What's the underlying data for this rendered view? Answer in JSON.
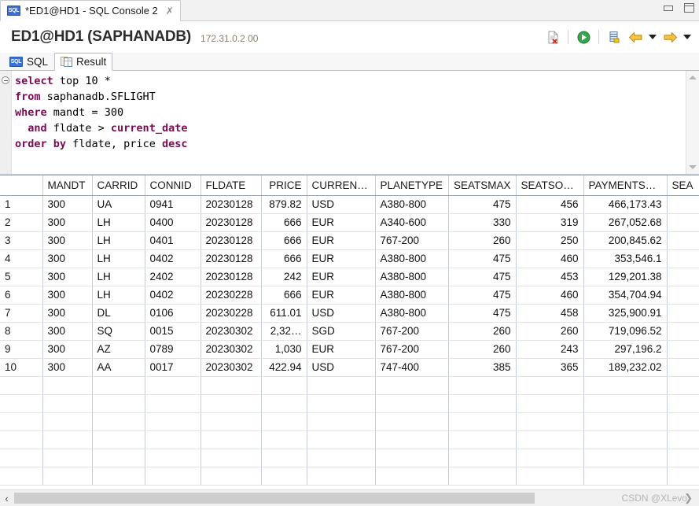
{
  "window": {
    "tab_title": "*ED1@HD1 - SQL Console 2",
    "tab_icon": "sql-badge-icon",
    "tab_close_glyph": "✗",
    "minimize_label": "Minimize",
    "maximize_label": "Maximize"
  },
  "header": {
    "title": "ED1@HD1 (SAPHANADB)",
    "host": "172.31.0.2 00",
    "tools": [
      {
        "name": "clear-console-icon",
        "title": "Clear console"
      },
      {
        "name": "execute-icon",
        "title": "Execute"
      },
      {
        "name": "save-to-db-icon",
        "title": "Save"
      },
      {
        "name": "back-arrow-icon",
        "title": "Back"
      },
      {
        "name": "back-dropdown-caret",
        "title": "Back history"
      },
      {
        "name": "forward-arrow-icon",
        "title": "Forward"
      },
      {
        "name": "forward-dropdown-caret",
        "title": "Forward history"
      }
    ]
  },
  "tabs": [
    {
      "label": "SQL",
      "icon": "sql-badge-icon",
      "active": false
    },
    {
      "label": "Result",
      "icon": "result-grid-icon",
      "active": true
    }
  ],
  "editor": {
    "lines": [
      [
        {
          "t": "select",
          "k": true
        },
        {
          "t": " top 10 *",
          "k": false
        }
      ],
      [
        {
          "t": "from",
          "k": true
        },
        {
          "t": " saphanadb.SFLIGHT",
          "k": false
        }
      ],
      [
        {
          "t": "where",
          "k": true
        },
        {
          "t": " mandt = 300",
          "k": false
        }
      ],
      [
        {
          "t": "  and",
          "k": true
        },
        {
          "t": " fldate > ",
          "k": false
        },
        {
          "t": "current_date",
          "k": true
        }
      ],
      [
        {
          "t": "order by",
          "k": true
        },
        {
          "t": " fldate, price ",
          "k": false
        },
        {
          "t": "desc",
          "k": true
        }
      ]
    ],
    "fold_marker": "collapse-icon",
    "keyword_color": "#7a0b52"
  },
  "result": {
    "columns": [
      {
        "key": "rownum",
        "label": "",
        "width": 54,
        "align": "left"
      },
      {
        "key": "MANDT",
        "label": "MANDT",
        "width": 63,
        "align": "left"
      },
      {
        "key": "CARRID",
        "label": "CARRID",
        "width": 67,
        "align": "left"
      },
      {
        "key": "CONNID",
        "label": "CONNID",
        "width": 71,
        "align": "left"
      },
      {
        "key": "FLDATE",
        "label": "FLDATE",
        "width": 77,
        "align": "left"
      },
      {
        "key": "PRICE",
        "label": "PRICE",
        "width": 58,
        "align": "right"
      },
      {
        "key": "CURRENCY",
        "label": "CURRENCY",
        "width": 87,
        "align": "left"
      },
      {
        "key": "PLANETYPE",
        "label": "PLANETYPE",
        "width": 93,
        "align": "left"
      },
      {
        "key": "SEATSMAX",
        "label": "SEATSMAX",
        "width": 86,
        "align": "right"
      },
      {
        "key": "SEATSOCC",
        "label": "SEATSOCC",
        "width": 86,
        "align": "right"
      },
      {
        "key": "PAYMENTSUM",
        "label": "PAYMENTSUM",
        "width": 106,
        "align": "right"
      },
      {
        "key": "SEATSMAX_B",
        "label": "SEA",
        "width": 52,
        "align": "left"
      }
    ],
    "rows": [
      {
        "rownum": "1",
        "MANDT": "300",
        "CARRID": "UA",
        "CONNID": "0941",
        "FLDATE": "20230128",
        "PRICE": "879.82",
        "CURRENCY": "USD",
        "PLANETYPE": "A380-800",
        "SEATSMAX": "475",
        "SEATSOCC": "456",
        "PAYMENTSUM": "466,173.43",
        "SEATSMAX_B": ""
      },
      {
        "rownum": "2",
        "MANDT": "300",
        "CARRID": "LH",
        "CONNID": "0400",
        "FLDATE": "20230128",
        "PRICE": "666",
        "CURRENCY": "EUR",
        "PLANETYPE": "A340-600",
        "SEATSMAX": "330",
        "SEATSOCC": "319",
        "PAYMENTSUM": "267,052.68",
        "SEATSMAX_B": ""
      },
      {
        "rownum": "3",
        "MANDT": "300",
        "CARRID": "LH",
        "CONNID": "0401",
        "FLDATE": "20230128",
        "PRICE": "666",
        "CURRENCY": "EUR",
        "PLANETYPE": "767-200",
        "SEATSMAX": "260",
        "SEATSOCC": "250",
        "PAYMENTSUM": "200,845.62",
        "SEATSMAX_B": ""
      },
      {
        "rownum": "4",
        "MANDT": "300",
        "CARRID": "LH",
        "CONNID": "0402",
        "FLDATE": "20230128",
        "PRICE": "666",
        "CURRENCY": "EUR",
        "PLANETYPE": "A380-800",
        "SEATSMAX": "475",
        "SEATSOCC": "460",
        "PAYMENTSUM": "353,546.1",
        "SEATSMAX_B": ""
      },
      {
        "rownum": "5",
        "MANDT": "300",
        "CARRID": "LH",
        "CONNID": "2402",
        "FLDATE": "20230128",
        "PRICE": "242",
        "CURRENCY": "EUR",
        "PLANETYPE": "A380-800",
        "SEATSMAX": "475",
        "SEATSOCC": "453",
        "PAYMENTSUM": "129,201.38",
        "SEATSMAX_B": ""
      },
      {
        "rownum": "6",
        "MANDT": "300",
        "CARRID": "LH",
        "CONNID": "0402",
        "FLDATE": "20230228",
        "PRICE": "666",
        "CURRENCY": "EUR",
        "PLANETYPE": "A380-800",
        "SEATSMAX": "475",
        "SEATSOCC": "460",
        "PAYMENTSUM": "354,704.94",
        "SEATSMAX_B": ""
      },
      {
        "rownum": "7",
        "MANDT": "300",
        "CARRID": "DL",
        "CONNID": "0106",
        "FLDATE": "20230228",
        "PRICE": "611.01",
        "CURRENCY": "USD",
        "PLANETYPE": "A380-800",
        "SEATSMAX": "475",
        "SEATSOCC": "458",
        "PAYMENTSUM": "325,900.91",
        "SEATSMAX_B": ""
      },
      {
        "rownum": "8",
        "MANDT": "300",
        "CARRID": "SQ",
        "CONNID": "0015",
        "FLDATE": "20230302",
        "PRICE": "2,32…",
        "CURRENCY": "SGD",
        "PLANETYPE": "767-200",
        "SEATSMAX": "260",
        "SEATSOCC": "260",
        "PAYMENTSUM": "719,096.52",
        "SEATSMAX_B": ""
      },
      {
        "rownum": "9",
        "MANDT": "300",
        "CARRID": "AZ",
        "CONNID": "0789",
        "FLDATE": "20230302",
        "PRICE": "1,030",
        "CURRENCY": "EUR",
        "PLANETYPE": "767-200",
        "SEATSMAX": "260",
        "SEATSOCC": "243",
        "PAYMENTSUM": "297,196.2",
        "SEATSMAX_B": ""
      },
      {
        "rownum": "10",
        "MANDT": "300",
        "CARRID": "AA",
        "CONNID": "0017",
        "FLDATE": "20230302",
        "PRICE": "422.94",
        "CURRENCY": "USD",
        "PLANETYPE": "747-400",
        "SEATSMAX": "385",
        "SEATSOCC": "365",
        "PAYMENTSUM": "189,232.02",
        "SEATSMAX_B": ""
      }
    ],
    "empty_rows": 6
  },
  "footer": {
    "scroll_left_glyph": "‹",
    "watermark_text": "CSDN @XLevo",
    "watermark_arrow": "❯"
  }
}
